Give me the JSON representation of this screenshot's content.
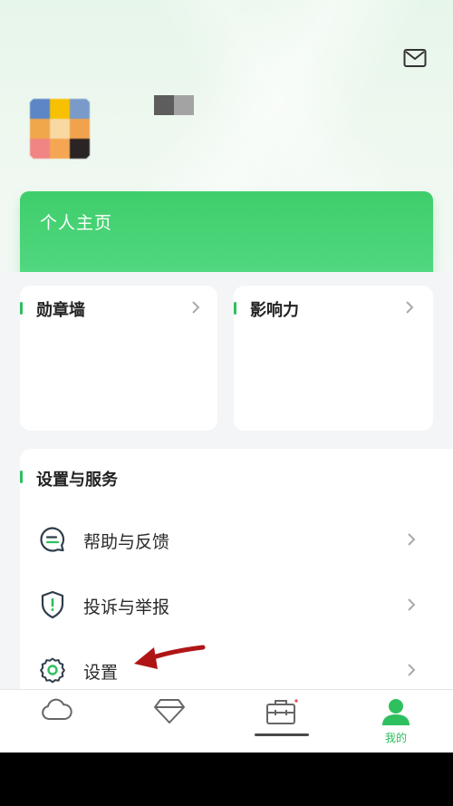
{
  "header": {
    "mail_icon": "mail-icon"
  },
  "profile": {
    "avatar_colors": [
      "#5c86c6",
      "#f7c000",
      "#7a9ac9",
      "#f0a64a",
      "#f8d9a1",
      "#f1a24d",
      "#f08583",
      "#f4a653",
      "#2a2424"
    ],
    "username_colors": [
      "#5d5d5d",
      "#a3a3a3"
    ]
  },
  "home_card": {
    "label": "个人主页"
  },
  "cards": {
    "badges": {
      "title": "勋章墙"
    },
    "influence": {
      "title": "影响力"
    }
  },
  "settings": {
    "section_title": "设置与服务",
    "items": [
      {
        "label": "帮助与反馈",
        "icon": "feedback-chat-icon"
      },
      {
        "label": "投诉与举报",
        "icon": "shield-exclamation-icon"
      },
      {
        "label": "设置",
        "icon": "gear-icon"
      }
    ]
  },
  "tabbar": {
    "tabs": [
      {
        "label": "",
        "icon": "cloud-icon"
      },
      {
        "label": "",
        "icon": "diamond-icon"
      },
      {
        "label": "",
        "icon": "toolbox-icon"
      },
      {
        "label": "我的",
        "icon": "person-icon"
      }
    ],
    "active_index": 3
  },
  "colors": {
    "accent": "#2ec05e",
    "annotation_arrow": "#b01515"
  }
}
